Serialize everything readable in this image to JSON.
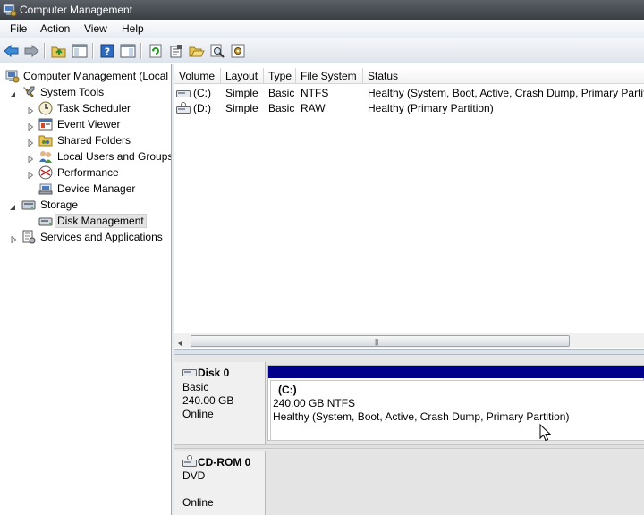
{
  "window": {
    "title": "Computer Management"
  },
  "menu": [
    "File",
    "Action",
    "View",
    "Help"
  ],
  "toolbar": {
    "buttons": [
      "back-arrow-icon",
      "forward-arrow-icon",
      "up-folder-icon",
      "show-hide-tree-icon",
      "help-icon",
      "show-hide-action-pane-icon",
      "refresh-icon",
      "properties-icon",
      "open-icon",
      "search-icon",
      "settings-icon"
    ]
  },
  "tree": {
    "root": "Computer Management (Local",
    "items": [
      {
        "label": "System Tools",
        "icon": "tools-icon"
      },
      {
        "label": "Task Scheduler",
        "icon": "clock-icon"
      },
      {
        "label": "Event Viewer",
        "icon": "event-viewer-icon"
      },
      {
        "label": "Shared Folders",
        "icon": "shared-folder-icon"
      },
      {
        "label": "Local Users and Groups",
        "icon": "users-icon"
      },
      {
        "label": "Performance",
        "icon": "performance-icon"
      },
      {
        "label": "Device Manager",
        "icon": "device-manager-icon"
      },
      {
        "label": "Storage",
        "icon": "storage-icon"
      },
      {
        "label": "Disk Management",
        "icon": "disk-icon"
      },
      {
        "label": "Services and Applications",
        "icon": "services-icon"
      }
    ]
  },
  "volumes": {
    "columns": [
      "Volume",
      "Layout",
      "Type",
      "File System",
      "Status"
    ],
    "rows": [
      {
        "volume": "(C:)",
        "layout": "Simple",
        "type": "Basic",
        "fs": "NTFS",
        "status": "Healthy (System, Boot, Active, Crash Dump, Primary Partition)"
      },
      {
        "volume": "(D:)",
        "layout": "Simple",
        "type": "Basic",
        "fs": "RAW",
        "status": "Healthy (Primary Partition)"
      }
    ]
  },
  "disks": [
    {
      "name": "Disk 0",
      "type": "Basic",
      "size": "240.00 GB",
      "state": "Online"
    },
    {
      "name": "CD-ROM 0",
      "type": "DVD",
      "size": "",
      "state": "Online"
    }
  ],
  "partition": {
    "label": "(C:)",
    "size_fs": "240.00 GB NTFS",
    "status": "Healthy (System, Boot, Active, Crash Dump, Primary Partition)",
    "header_color": "#00008b"
  }
}
